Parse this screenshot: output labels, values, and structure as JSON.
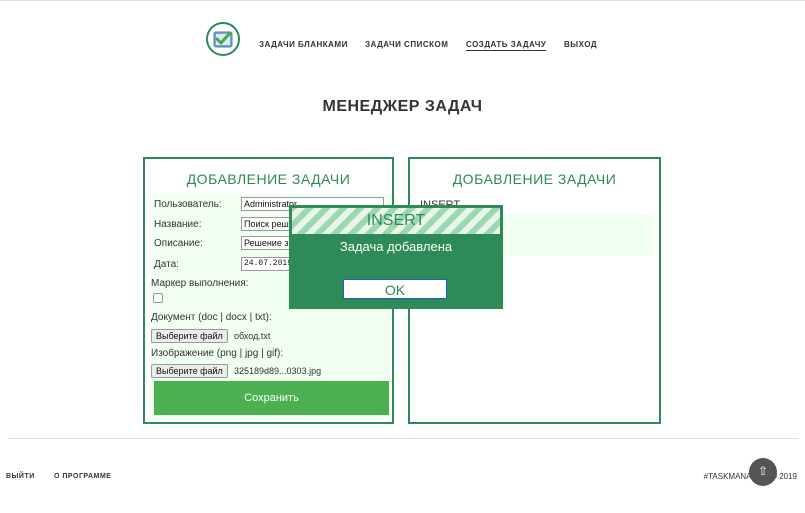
{
  "nav": {
    "items": [
      "ЗАДАЧИ БЛАНКАМИ",
      "ЗАДАЧИ СПИСКОМ",
      "СОЗДАТЬ ЗАДАЧУ",
      "ВЫХОД"
    ],
    "active_index": 2
  },
  "page_title": "МЕНЕДЖЕР ЗАДАЧ",
  "left_panel": {
    "title": "ДОБАВЛЕНИЕ ЗАДАЧИ",
    "user_label": "Пользователь:",
    "user_value": "Administrator",
    "name_label": "Название:",
    "name_value": "Поиск решения",
    "description_label": "Описание:",
    "description_value": "Решение задачи",
    "date_label": "Дата:",
    "date_value": "24.07.2019",
    "marker_label": "Маркер выполнения:",
    "document_label": "Документ (doc | docx | txt):",
    "document_button": "Выберите файл",
    "document_file": "обход.txt",
    "image_label": "Изображение (png | jpg | gif):",
    "image_button": "Выберите файл",
    "image_file": "325189d89...0303.jpg",
    "save_button": "Сохранить"
  },
  "right_panel": {
    "title": "ДОБАВЛЕНИЕ ЗАДАЧИ",
    "text": "INSERT"
  },
  "modal": {
    "header": "INSERT",
    "message": "Задача добавлена",
    "ok_button": "OK"
  },
  "footer": {
    "links": [
      "ВЫЙТИ",
      "О ПРОГРАММЕ"
    ],
    "right_text": "#TASKMANAGER © 2019",
    "scroll_top_icon": "⇧"
  },
  "colors": {
    "accent": "#2e8b57",
    "save_button": "#4caf50",
    "panel_background": "#f0fff0"
  },
  "icons": [
    "checklist-logo-icon",
    "arrow-up-icon"
  ]
}
